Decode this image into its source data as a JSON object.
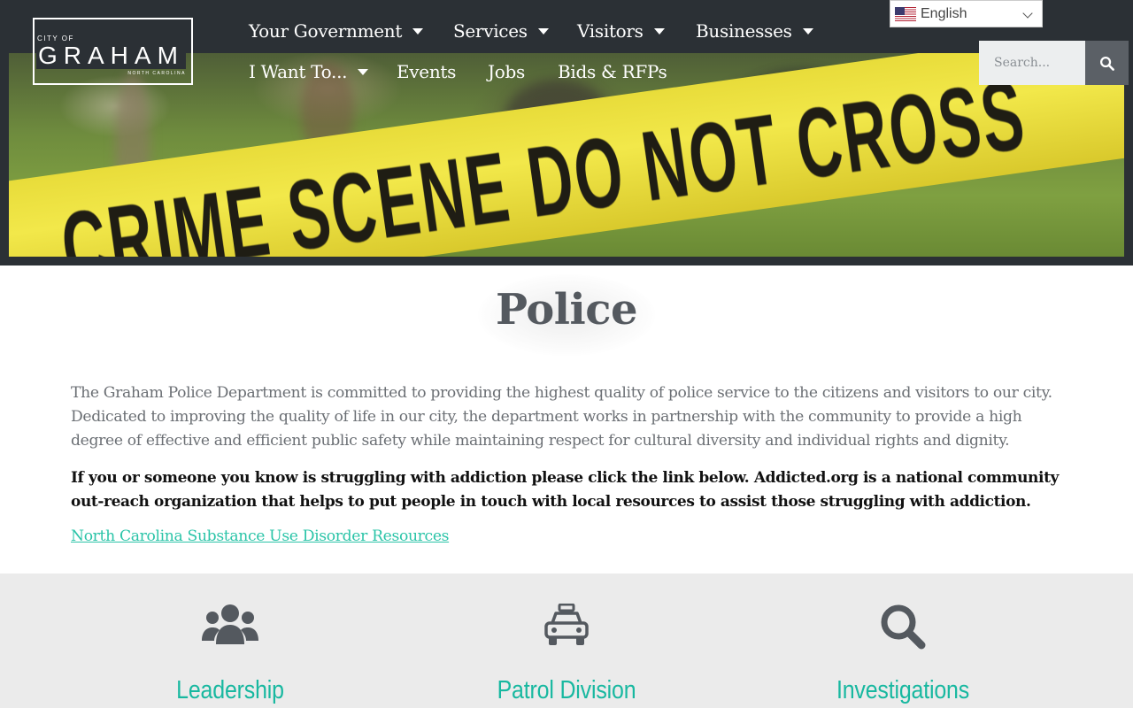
{
  "logo": {
    "top": "CITY OF",
    "main": "GRAHAM",
    "sub": "NORTH CAROLINA"
  },
  "nav": {
    "row1": [
      {
        "label": "Your Government",
        "dropdown": true
      },
      {
        "label": "Services",
        "dropdown": true
      },
      {
        "label": "Visitors",
        "dropdown": true
      },
      {
        "label": "Businesses",
        "dropdown": true
      }
    ],
    "row2": [
      {
        "label": "I Want To...",
        "dropdown": true
      },
      {
        "label": "Events",
        "dropdown": false
      },
      {
        "label": "Jobs",
        "dropdown": false
      },
      {
        "label": "Bids & RFPs",
        "dropdown": false
      }
    ]
  },
  "language": {
    "selected": "English",
    "flag": "us-flag-icon"
  },
  "search": {
    "placeholder": "Search...",
    "icon": "search-icon"
  },
  "hero": {
    "tape_text": "CRIME SCENE DO NOT CROSS"
  },
  "main": {
    "title": "Police",
    "intro": "The Graham Police Department is committed to providing the highest quality of police service to the citizens and visitors to our city. Dedicated to improving the quality of life in our city, the department works in partnership with the community to provide a high degree of effective and efficient public safety while maintaining respect for cultural diversity and individual rights and dignity.",
    "notice": "If you or someone you know is struggling with addiction please click the link below. Addicted.org is a national community out-reach organization that helps to put people in touch with local resources to assist those struggling with addiction.",
    "link": "North Carolina Substance Use Disorder Resources"
  },
  "services": [
    {
      "label": "Leadership",
      "icon": "users-icon"
    },
    {
      "label": "Patrol Division",
      "icon": "taxi-car-icon"
    },
    {
      "label": "Investigations",
      "icon": "magnifier-icon"
    }
  ],
  "colors": {
    "header_bg": "#2b3035",
    "accent": "#18b8a0",
    "link": "#2bc4a8",
    "services_bg": "#ebebeb"
  }
}
